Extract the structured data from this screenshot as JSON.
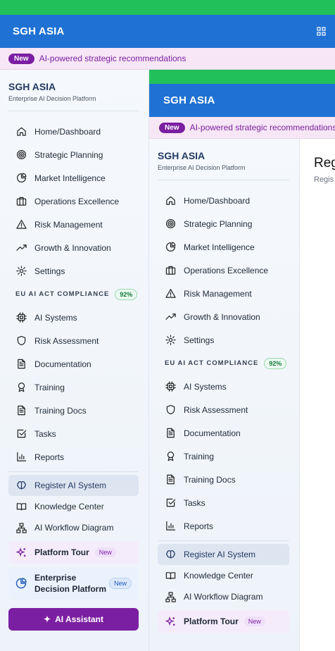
{
  "app": {
    "brand": "SGH ASIA"
  },
  "banner": {
    "badge": "New",
    "message": "AI-powered strategic recommendations"
  },
  "sidebar": {
    "title": "SGH ASIA",
    "subtitle": "Enterprise AI Decision Platform",
    "nav": [
      {
        "label": "Home/Dashboard",
        "icon": "home-icon"
      },
      {
        "label": "Strategic Planning",
        "icon": "target-icon"
      },
      {
        "label": "Market Intelligence",
        "icon": "pie-chart-icon"
      },
      {
        "label": "Operations Excellence",
        "icon": "briefcase-icon"
      },
      {
        "label": "Risk Management",
        "icon": "warning-icon"
      },
      {
        "label": "Growth & Innovation",
        "icon": "trending-up-icon"
      },
      {
        "label": "Settings",
        "icon": "gear-icon"
      }
    ],
    "compliance": {
      "label": "EU AI ACT COMPLIANCE",
      "percent": "92%"
    },
    "compliance_items": [
      {
        "label": "AI Systems",
        "icon": "chip-icon"
      },
      {
        "label": "Risk Assessment",
        "icon": "shield-icon"
      },
      {
        "label": "Documentation",
        "icon": "document-icon"
      },
      {
        "label": "Training",
        "icon": "award-icon"
      },
      {
        "label": "Training Docs",
        "icon": "document-icon"
      },
      {
        "label": "Tasks",
        "icon": "checkbox-icon"
      },
      {
        "label": "Reports",
        "icon": "bar-chart-icon"
      }
    ],
    "register": "Register AI System",
    "knowledge": "Knowledge Center",
    "workflow": "AI Workflow Diagram",
    "tour": {
      "label": "Platform Tour",
      "badge": "New"
    },
    "edp": {
      "label": "Enterprise Decision Platform",
      "badge": "New"
    },
    "assistant": "AI Assistant"
  },
  "content": {
    "heading": "Regi",
    "sub": "Regis"
  },
  "colors": {
    "header": "#1f72d4",
    "topbar": "#22c05a",
    "accent": "#7b1fa2"
  }
}
